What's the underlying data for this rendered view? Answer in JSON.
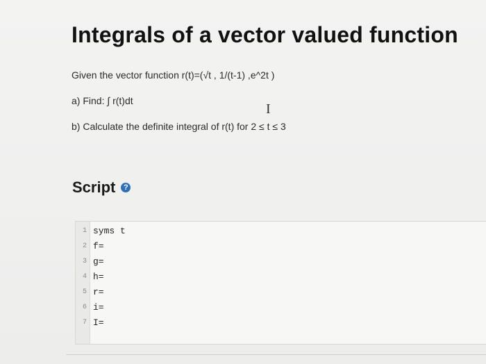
{
  "title": "Integrals of a vector valued function",
  "question": {
    "intro": "Given the vector function r(t)=(√t , 1/(t-1) ,e^2t )",
    "part_a": "a) Find: ∫ r(t)dt",
    "part_b": "b) Calculate the definite integral of r(t) for 2 ≤ t ≤ 3"
  },
  "script": {
    "heading": "Script",
    "help_glyph": "?",
    "lines": [
      {
        "num": "1",
        "code": "syms t"
      },
      {
        "num": "2",
        "code": "f="
      },
      {
        "num": "3",
        "code": "g="
      },
      {
        "num": "4",
        "code": "h="
      },
      {
        "num": "5",
        "code": "r="
      },
      {
        "num": "6",
        "code": "i="
      },
      {
        "num": "7",
        "code": "I="
      }
    ]
  },
  "icons": {
    "text_cursor": "I"
  },
  "colors": {
    "help_icon": "#2f6fb6"
  }
}
